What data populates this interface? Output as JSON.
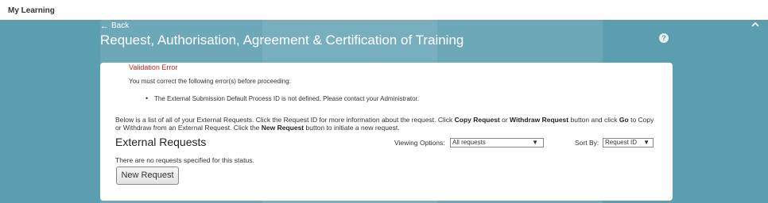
{
  "topbar": {
    "title": "My Learning"
  },
  "header": {
    "back_label": "Back",
    "page_title": "Request, Authorisation, Agreement & Certification of Training",
    "help_icon": "question-circle-icon",
    "collapse_icon": "chevron-up-icon"
  },
  "validation": {
    "title": "Validation Error",
    "message": "You must correct the following error(s) before proceeding:",
    "errors": [
      "The External Submission Default Process ID is not defined. Please contact your Administrator."
    ]
  },
  "info": {
    "part1": "Below is a list of all of your External Requests. Click the Request ID for more information about the request. Click ",
    "copy": "Copy Request",
    "part2": " or ",
    "withdraw": "Withdraw Request",
    "part3": " button and click ",
    "go": "Go",
    "part4": " to Copy or Withdraw from an External Request. Click the ",
    "new_request": "New Request",
    "part5": " button to initiate a new request."
  },
  "section": {
    "title": "External Requests"
  },
  "viewing": {
    "label": "Viewing Options:",
    "selected": "All requests"
  },
  "sort": {
    "label": "Sort By:",
    "selected": "Request ID"
  },
  "empty_message": "There are no requests specified for this status.",
  "new_request_button": "New Request",
  "colors": {
    "banner": "#5b9eb0",
    "error": "#cc2222"
  }
}
